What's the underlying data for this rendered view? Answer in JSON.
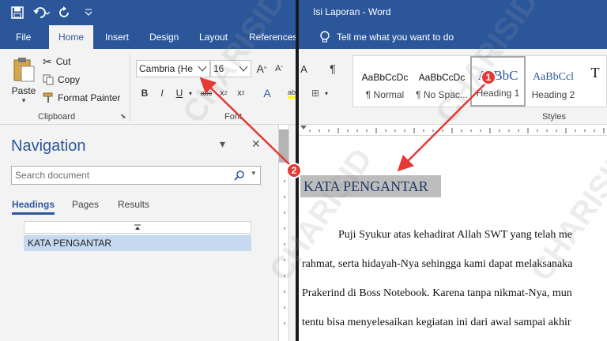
{
  "window": {
    "title": "Isi Laporan  -  Word"
  },
  "tabs": [
    {
      "label": "File"
    },
    {
      "label": "Home"
    },
    {
      "label": "Insert"
    },
    {
      "label": "Design"
    },
    {
      "label": "Layout"
    },
    {
      "label": "References"
    }
  ],
  "tell_me": "Tell me what you want to do",
  "clipboard": {
    "paste": "Paste",
    "cut": "Cut",
    "copy": "Copy",
    "format_painter": "Format Painter",
    "group_label": "Clipboard"
  },
  "font": {
    "name": "Cambria (He",
    "size": "16",
    "group_label": "Font"
  },
  "styles": {
    "items": [
      {
        "sample": "AaBbCcDc",
        "name": "¶ Normal"
      },
      {
        "sample": "AaBbCcDc",
        "name": "¶ No Spac..."
      },
      {
        "sample": "AaBbC",
        "name": "Heading 1"
      },
      {
        "sample": "AaBbCcl",
        "name": "Heading 2"
      },
      {
        "sample": "T",
        "name": ""
      }
    ],
    "group_label": "Styles"
  },
  "navigation": {
    "title": "Navigation",
    "search_placeholder": "Search document",
    "tabs": [
      "Headings",
      "Pages",
      "Results"
    ],
    "headings": [
      "KATA PENGANTAR"
    ]
  },
  "document": {
    "heading": "KATA PENGANTAR",
    "lines": [
      "Puji Syukur atas kehadirat Allah SWT yang telah me",
      "rahmat, serta hidayah-Nya sehingga kami dapat melaksanaka",
      "Prakerind di Boss Notebook. Karena tanpa nikmat-Nya, mun",
      "tentu bisa menyelesaikan kegiatan ini dari awal sampai akhir"
    ]
  },
  "annotations": [
    {
      "label": "1"
    },
    {
      "label": "2"
    }
  ],
  "watermark": "CHARISID",
  "colors": {
    "accent": "#2b579a",
    "annotation": "#e53935",
    "heading_highlight": "#bdbdbd",
    "nav_selected": "#c5d9f1"
  }
}
